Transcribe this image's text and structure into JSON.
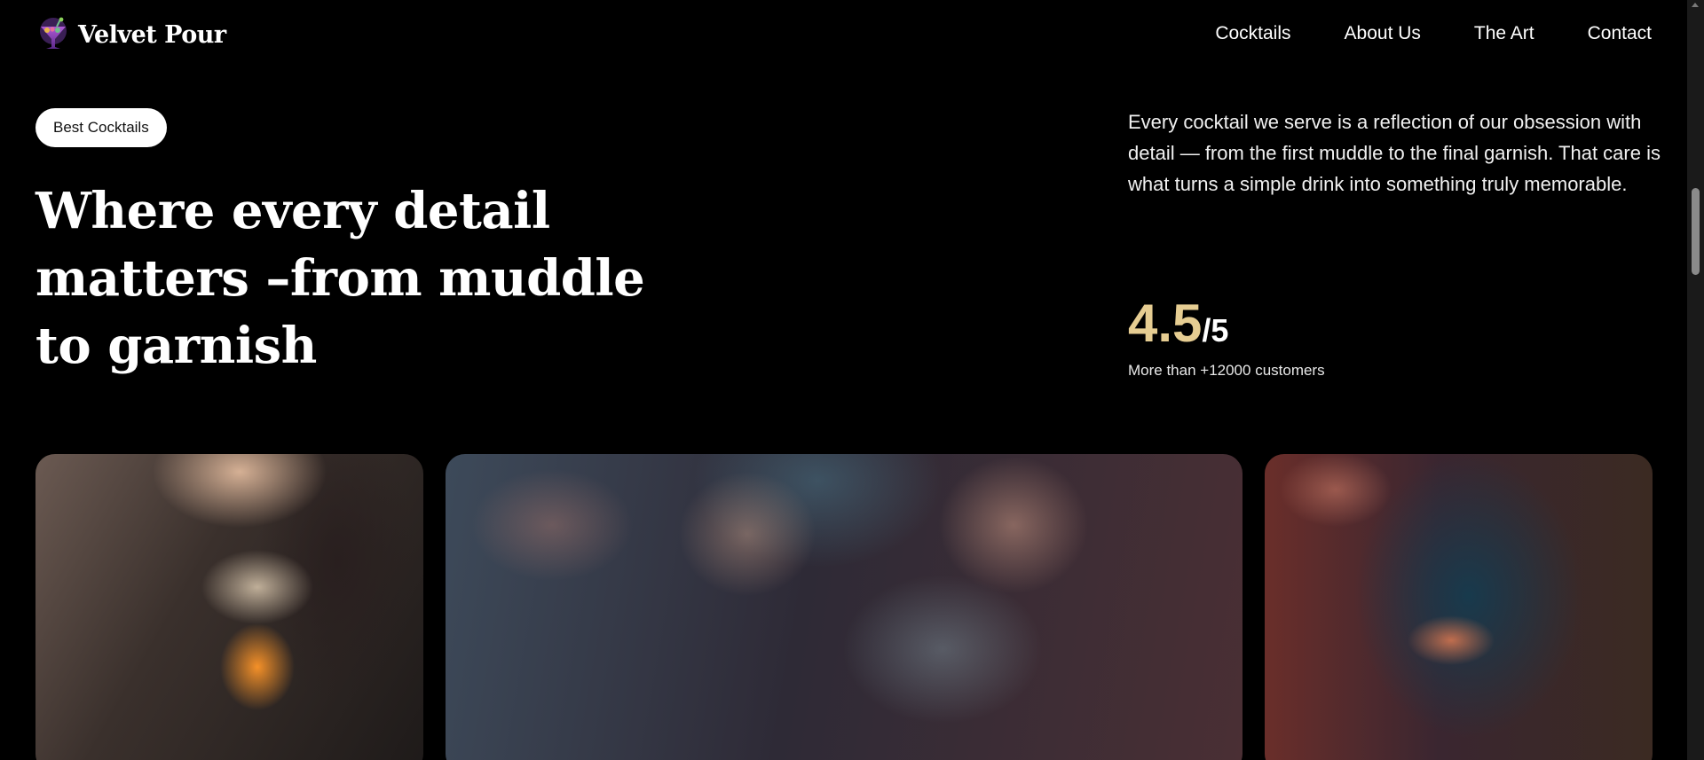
{
  "brand": {
    "name": "Velvet Pour",
    "logo_icon": "cocktail-glass-icon"
  },
  "nav": {
    "items": [
      {
        "label": "Cocktails"
      },
      {
        "label": "About Us"
      },
      {
        "label": "The Art"
      },
      {
        "label": "Contact"
      }
    ]
  },
  "hero": {
    "tag": "Best Cocktails",
    "headline_lines": [
      "Where every detail",
      "matters –from muddle",
      "to garnish"
    ],
    "intro": "Every cocktail we serve is a reflection of our obsession with detail — from the first muddle to the final garnish. That care is what turns a simple drink into something truly memorable.",
    "rating": {
      "value": "4.5",
      "max": "/5",
      "caption": "More than +12000 customers"
    }
  },
  "gallery": {
    "images": [
      {
        "subject": "bartender garnishing cocktail"
      },
      {
        "subject": "friends toasting at bar"
      },
      {
        "subject": "bartender pouring martini"
      }
    ]
  },
  "colors": {
    "background": "#000000",
    "accent": "#e6cd92",
    "text": "#ffffff"
  }
}
